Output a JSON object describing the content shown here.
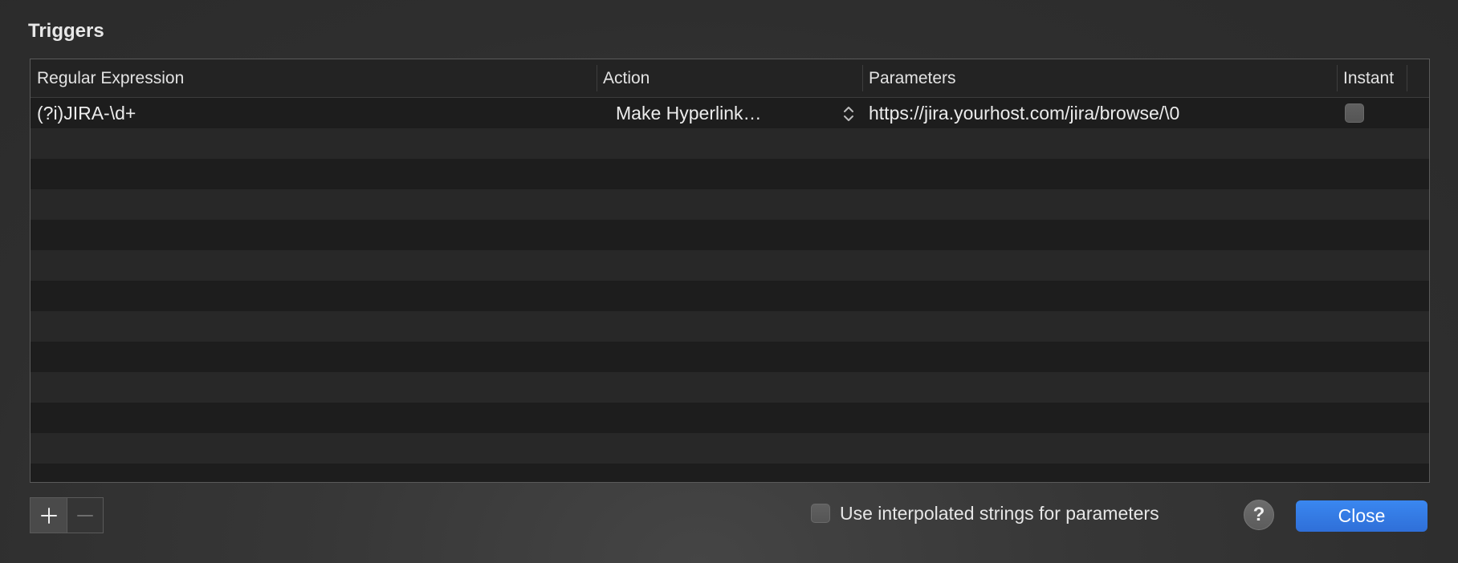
{
  "panel": {
    "title": "Triggers"
  },
  "table": {
    "columns": [
      "Regular Expression",
      "Action",
      "Parameters",
      "Instant"
    ],
    "rows": [
      {
        "regex": "(?i)JIRA-\\d+",
        "action": "Make Hyperlink…",
        "parameters": "https://jira.yourhost.com/jira/browse/\\0",
        "instant": false
      }
    ]
  },
  "icons": {
    "add": "plus-icon",
    "remove": "minus-icon",
    "popup": "chevron-updown-icon"
  },
  "footer": {
    "interpolated_label": "Use interpolated strings for parameters",
    "interpolated_checked": false,
    "help_label": "?",
    "close_label": "Close"
  },
  "colors": {
    "accent": "#2f6fd8",
    "background": "#2e2e2e"
  }
}
